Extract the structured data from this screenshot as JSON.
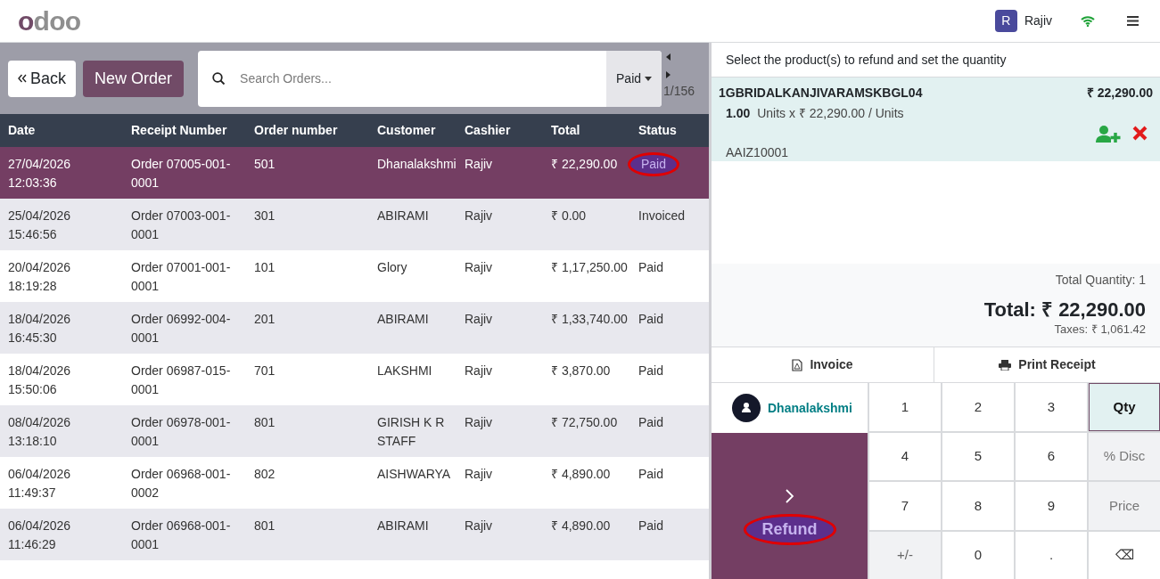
{
  "header": {
    "logo": "odoo",
    "user": {
      "initial": "R",
      "name": "Rajiv"
    }
  },
  "toolbar": {
    "back": "Back",
    "new_order": "New Order",
    "search": {
      "placeholder": "Search Orders..."
    },
    "filter": "Paid",
    "pager": "1/156"
  },
  "table": {
    "columns": [
      "Date",
      "Receipt Number",
      "Order number",
      "Customer",
      "Cashier",
      "Total",
      "Status"
    ],
    "rows": [
      {
        "selected": true,
        "highlighted": true,
        "cells": [
          "27/04/2026\n12:03:36",
          "Order 07005-001-\n0001",
          "501",
          "Dhanalakshmi",
          "Rajiv",
          "₹ 22,290.00",
          "Paid"
        ]
      },
      {
        "selected": false,
        "highlighted": false,
        "cells": [
          "25/04/2026\n15:46:56",
          "Order 07003-001-\n0001",
          "301",
          "ABIRAMI",
          "Rajiv",
          "₹ 0.00",
          "Invoiced"
        ]
      },
      {
        "selected": false,
        "highlighted": false,
        "cells": [
          "20/04/2026\n18:19:28",
          "Order 07001-001-\n0001",
          "101",
          "Glory",
          "Rajiv",
          "₹ 1,17,250.00",
          "Paid"
        ]
      },
      {
        "selected": false,
        "highlighted": false,
        "cells": [
          "18/04/2026\n16:45:30",
          "Order 06992-004-\n0001",
          "201",
          "ABIRAMI",
          "Rajiv",
          "₹ 1,33,740.00",
          "Paid"
        ]
      },
      {
        "selected": false,
        "highlighted": false,
        "cells": [
          "18/04/2026\n15:50:06",
          "Order 06987-015-\n0001",
          "701",
          "LAKSHMI",
          "Rajiv",
          "₹ 3,870.00",
          "Paid"
        ]
      },
      {
        "selected": false,
        "highlighted": false,
        "cells": [
          "08/04/2026\n13:18:10",
          "Order 06978-001-\n0001",
          "801",
          "GIRISH K R\nSTAFF",
          "Rajiv",
          "₹ 72,750.00",
          "Paid"
        ]
      },
      {
        "selected": false,
        "highlighted": false,
        "cells": [
          "06/04/2026\n11:49:37",
          "Order 06968-001-\n0002",
          "802",
          "AISHWARYA",
          "Rajiv",
          "₹ 4,890.00",
          "Paid"
        ]
      },
      {
        "selected": false,
        "highlighted": false,
        "cells": [
          "06/04/2026\n11:46:29",
          "Order 06968-001-\n0001",
          "801",
          "ABIRAMI",
          "Rajiv",
          "₹ 4,890.00",
          "Paid"
        ]
      }
    ]
  },
  "refund_panel": {
    "instruction": "Select the product(s) to refund and set the quantity",
    "line": {
      "product": "1GBRIDALKANJIVARAMSKBGL04",
      "price": "₹ 22,290.00",
      "quantity": "1.00",
      "unit_text": "Units x ₹ 22,290.00 / Units",
      "lot": "AAIZ10001"
    },
    "total_quantity": "Total Quantity: 1",
    "total": "Total: ₹ 22,290.00",
    "taxes": "Taxes: ₹ 1,061.42",
    "actions": [
      "Invoice",
      "Print Receipt"
    ],
    "customer": "Dhanalakshmi",
    "refund": {
      "label": "Refund",
      "highlighted": true
    },
    "keys": [
      {
        "kind": "number",
        "label": "1"
      },
      {
        "kind": "number",
        "label": "2"
      },
      {
        "kind": "number",
        "label": "3"
      },
      {
        "kind": "mode",
        "label": "Qty",
        "selected": true
      },
      {
        "kind": "number",
        "label": "4"
      },
      {
        "kind": "number",
        "label": "5"
      },
      {
        "kind": "number",
        "label": "6"
      },
      {
        "kind": "mode",
        "label": "% Disc",
        "selected": false
      },
      {
        "kind": "number",
        "label": "7"
      },
      {
        "kind": "number",
        "label": "8"
      },
      {
        "kind": "number",
        "label": "9"
      },
      {
        "kind": "mode",
        "label": "Price",
        "selected": false
      },
      {
        "kind": "sign",
        "label": "+/-"
      },
      {
        "kind": "number",
        "label": "0"
      },
      {
        "kind": "number",
        "label": "."
      },
      {
        "kind": "backspace",
        "label": "⌫"
      }
    ]
  }
}
